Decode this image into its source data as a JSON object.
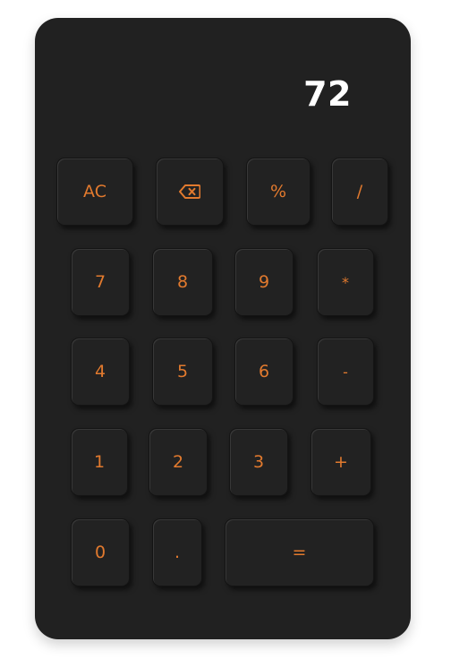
{
  "display": {
    "value": "72"
  },
  "keys": {
    "clear": "AC",
    "backspace_icon": "backspace-icon",
    "percent": "%",
    "divide": "/",
    "seven": "7",
    "eight": "8",
    "nine": "9",
    "multiply": "*",
    "four": "4",
    "five": "5",
    "six": "6",
    "subtract": "-",
    "one": "1",
    "two": "2",
    "three": "3",
    "add": "+",
    "zero": "0",
    "decimal": ".",
    "equals": "="
  },
  "colors": {
    "body": "#212121",
    "accent": "#e27a2e",
    "display_text": "#ffffff"
  }
}
